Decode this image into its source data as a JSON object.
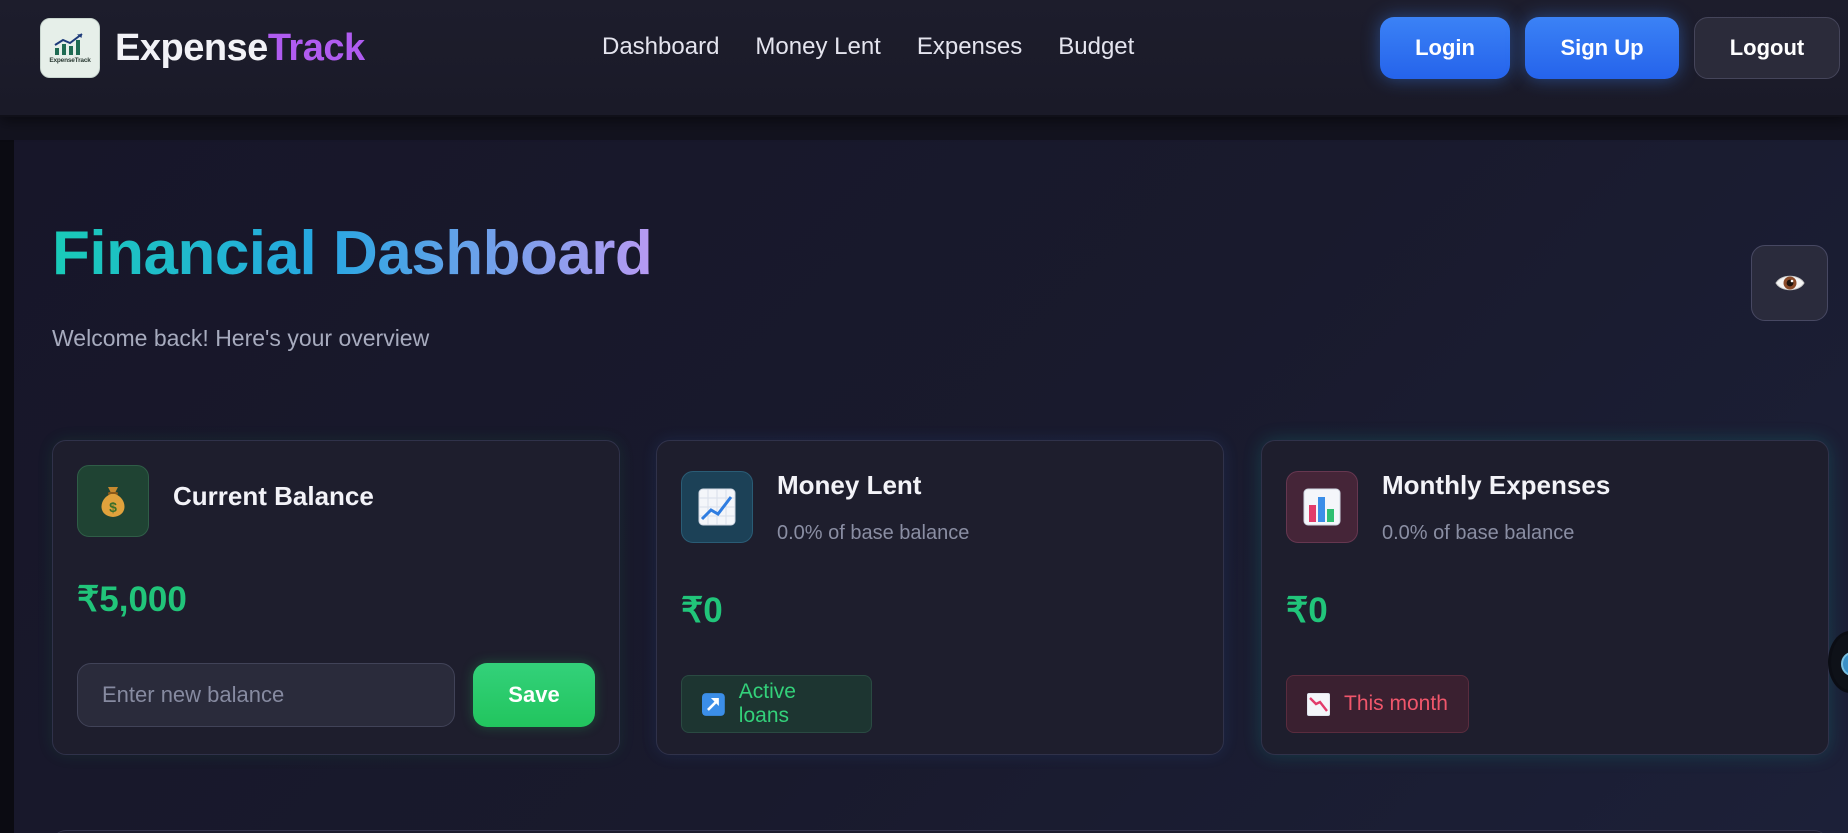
{
  "navbar": {
    "logo_text": "ExpenseTrack",
    "brand_part1": "Expense",
    "brand_part2": "Track",
    "links": [
      "Dashboard",
      "Money Lent",
      "Expenses",
      "Budget"
    ],
    "login_label": "Login",
    "signup_label": "Sign Up",
    "logout_label": "Logout"
  },
  "header": {
    "title": "Financial Dashboard",
    "subtitle": "Welcome back! Here's your overview",
    "visibility_icon": "eye-icon"
  },
  "cards": [
    {
      "icon": "money-bag-icon",
      "title": "Current Balance",
      "value": "₹5,000",
      "input_placeholder": "Enter new balance",
      "input_value": "",
      "button_label": "Save"
    },
    {
      "icon": "chart-increasing-icon",
      "title": "Money Lent",
      "subtitle": "0.0% of base balance",
      "value": "₹0",
      "tag_icon": "arrow-up-right-icon",
      "tag_label": "Active loans"
    },
    {
      "icon": "bar-chart-icon",
      "title": "Monthly Expenses",
      "subtitle": "0.0% of base balance",
      "value": "₹0",
      "tag_icon": "chart-decreasing-icon",
      "tag_label": "This month"
    }
  ],
  "colors": {
    "accent_blue": "#2563eb",
    "accent_green": "#22c55e",
    "accent_purple": "#b05cf0",
    "value_green": "#21c57a",
    "tag_red": "#f0566b"
  }
}
